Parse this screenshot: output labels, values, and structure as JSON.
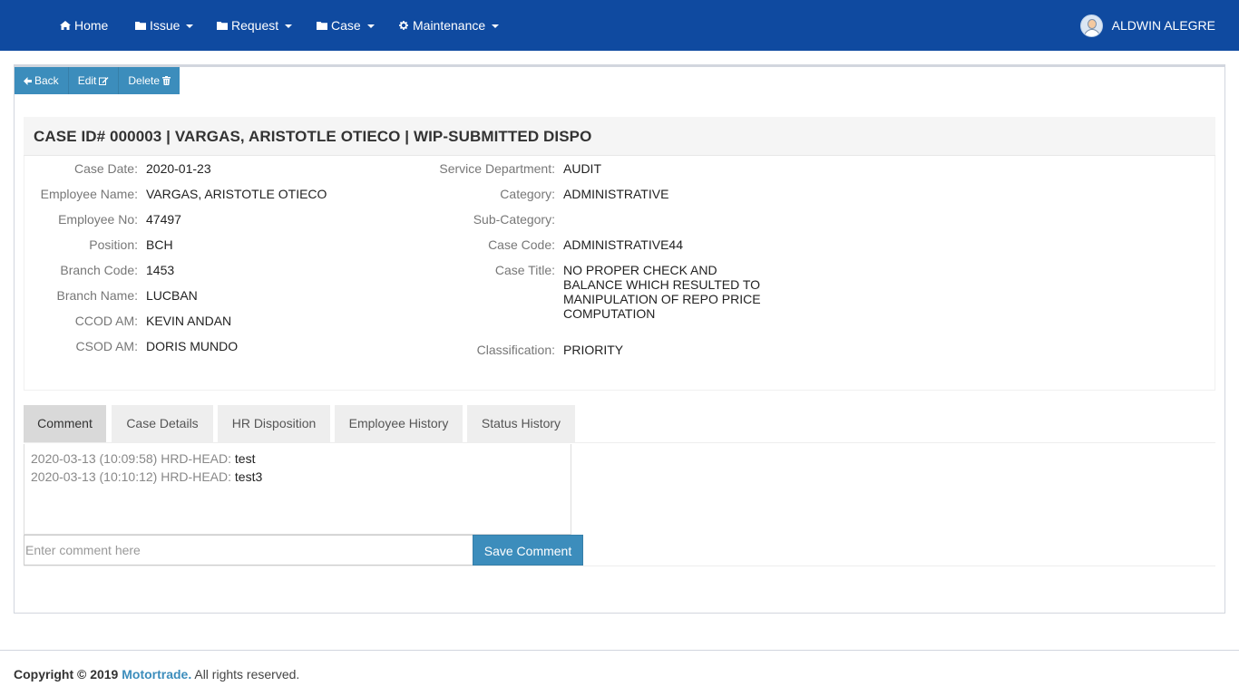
{
  "nav": {
    "items": [
      {
        "label": "Home",
        "icon": "home-icon",
        "has_caret": false
      },
      {
        "label": "Issue",
        "icon": "folder-icon",
        "has_caret": true
      },
      {
        "label": "Request",
        "icon": "folder-icon",
        "has_caret": true
      },
      {
        "label": "Case",
        "icon": "folder-icon",
        "has_caret": true
      },
      {
        "label": "Maintenance",
        "icon": "gear-icon",
        "has_caret": true
      }
    ],
    "user_name": "ALDWIN ALEGRE",
    "bg_color": "#0f4aa0"
  },
  "toolbar": {
    "back_label": "Back",
    "edit_label": "Edit",
    "delete_label": "Delete"
  },
  "case": {
    "title": "CASE ID# 000003 | VARGAS, ARISTOTLE OTIECO | WIP-SUBMITTED DISPO",
    "left_fields": [
      {
        "label": "Case Date:",
        "value": "2020-01-23"
      },
      {
        "label": "Employee Name:",
        "value": "VARGAS, ARISTOTLE OTIECO"
      },
      {
        "label": "Employee No:",
        "value": "47497"
      },
      {
        "label": "Position:",
        "value": "BCH"
      },
      {
        "label": "Branch Code:",
        "value": "1453"
      },
      {
        "label": "Branch Name:",
        "value": "LUCBAN"
      },
      {
        "label": "CCOD AM:",
        "value": "KEVIN ANDAN"
      },
      {
        "label": "CSOD AM:",
        "value": "DORIS MUNDO"
      }
    ],
    "right_fields": [
      {
        "label": "Service Department:",
        "value": "AUDIT"
      },
      {
        "label": "Category:",
        "value": "ADMINISTRATIVE"
      },
      {
        "label": "Sub-Category:",
        "value": ""
      },
      {
        "label": "Case Code:",
        "value": "ADMINISTRATIVE44"
      },
      {
        "label": "Case Title:",
        "value": "NO PROPER CHECK AND BALANCE WHICH RESULTED TO MANIPULATION OF REPO PRICE COMPUTATION"
      },
      {
        "label": "Classification:",
        "value": "PRIORITY"
      }
    ]
  },
  "tabs": [
    {
      "label": "Comment",
      "active": true
    },
    {
      "label": "Case Details",
      "active": false
    },
    {
      "label": "HR Disposition",
      "active": false
    },
    {
      "label": "Employee History",
      "active": false
    },
    {
      "label": "Status History",
      "active": false
    }
  ],
  "comments": [
    {
      "meta": "2020-03-13 (10:09:58) HRD-HEAD:",
      "text": "test"
    },
    {
      "meta": "2020-03-13 (10:10:12) HRD-HEAD:",
      "text": "test3"
    }
  ],
  "comment_form": {
    "placeholder": "Enter comment here",
    "save_label": "Save Comment"
  },
  "footer": {
    "prefix": "Copyright © 2019",
    "brand": "Motortrade.",
    "suffix": "All rights reserved."
  },
  "colors": {
    "accent": "#3c8dbc",
    "navbar": "#0f4aa0"
  }
}
